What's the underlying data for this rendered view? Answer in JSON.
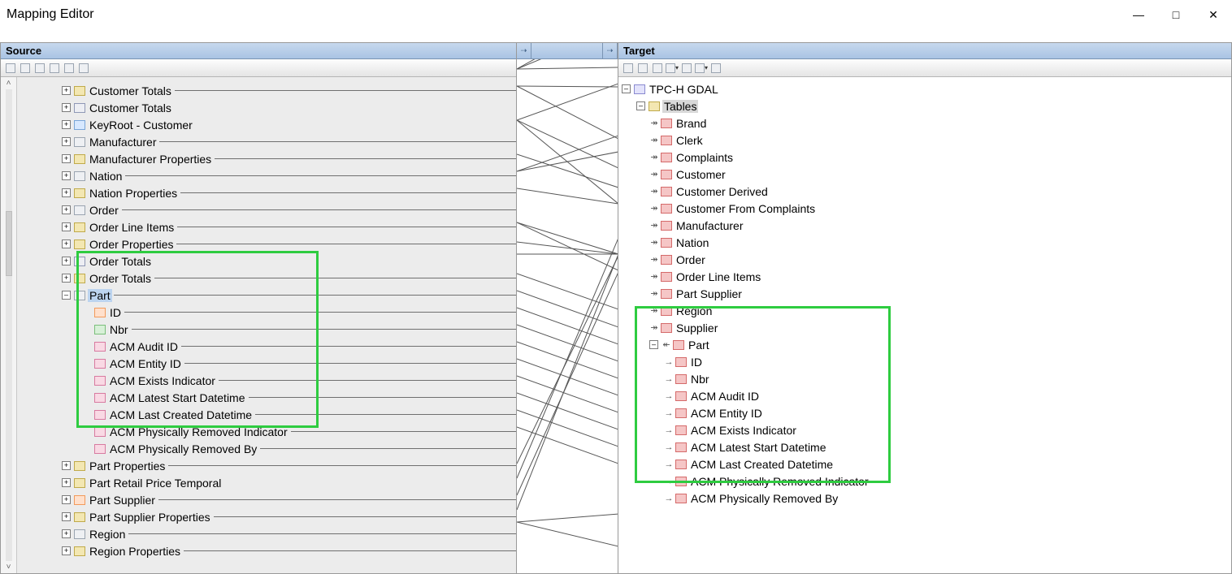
{
  "window": {
    "title": "Mapping Editor",
    "min": "—",
    "max": "□",
    "close": "✕"
  },
  "panels": {
    "source": "Source",
    "target": "Target"
  },
  "source_toolbar": [
    "tb1",
    "tb2",
    "tb3",
    "tb4",
    "tb5",
    "tb6"
  ],
  "target_toolbar": [
    "tt1",
    "tt2",
    "tt3",
    "tt4",
    "tt5",
    "tt6",
    "tt7"
  ],
  "source_tree": [
    {
      "exp": "+",
      "ico": "ic-folder",
      "label": "Customer Totals",
      "line": true
    },
    {
      "exp": "+",
      "ico": "ic-chart",
      "label": "Customer Totals"
    },
    {
      "exp": "+",
      "ico": "ic-key",
      "label": "KeyRoot - Customer"
    },
    {
      "exp": "+",
      "ico": "ic-grid",
      "label": "Manufacturer",
      "line": true
    },
    {
      "exp": "+",
      "ico": "ic-folder",
      "label": "Manufacturer Properties",
      "line": true
    },
    {
      "exp": "+",
      "ico": "ic-grid",
      "label": "Nation",
      "line": true
    },
    {
      "exp": "+",
      "ico": "ic-folder",
      "label": "Nation Properties",
      "line": true
    },
    {
      "exp": "+",
      "ico": "ic-grid",
      "label": "Order",
      "line": true
    },
    {
      "exp": "+",
      "ico": "ic-folder",
      "label": "Order Line Items",
      "line": true
    },
    {
      "exp": "+",
      "ico": "ic-folder",
      "label": "Order Properties",
      "line": true
    },
    {
      "exp": "+",
      "ico": "ic-chart",
      "label": "Order Totals"
    },
    {
      "exp": "+",
      "ico": "ic-folder",
      "label": "Order Totals",
      "line": true
    },
    {
      "exp": "–",
      "ico": "ic-grid",
      "label": "Part",
      "line": true,
      "highlight": true
    },
    {
      "child": true,
      "ico": "ic-orange",
      "label": "ID",
      "line": true
    },
    {
      "child": true,
      "ico": "ic-green",
      "label": "Nbr",
      "line": true
    },
    {
      "child": true,
      "ico": "ic-pink",
      "label": "ACM Audit ID",
      "line": true
    },
    {
      "child": true,
      "ico": "ic-pink",
      "label": "ACM Entity ID",
      "line": true
    },
    {
      "child": true,
      "ico": "ic-pink",
      "label": "ACM Exists Indicator",
      "line": true
    },
    {
      "child": true,
      "ico": "ic-pink",
      "label": "ACM Latest Start Datetime",
      "line": true
    },
    {
      "child": true,
      "ico": "ic-pink",
      "label": "ACM Last Created Datetime",
      "line": true
    },
    {
      "child": true,
      "ico": "ic-pink",
      "label": "ACM Physically Removed Indicator",
      "line": true
    },
    {
      "child": true,
      "ico": "ic-pink",
      "label": "ACM Physically Removed By",
      "line": true
    },
    {
      "exp": "+",
      "ico": "ic-folder",
      "label": "Part Properties",
      "line": true
    },
    {
      "exp": "+",
      "ico": "ic-folder",
      "label": "Part Retail Price Temporal"
    },
    {
      "exp": "+",
      "ico": "ic-orange",
      "label": "Part Supplier",
      "line": true
    },
    {
      "exp": "+",
      "ico": "ic-folder",
      "label": "Part Supplier Properties",
      "line": true
    },
    {
      "exp": "+",
      "ico": "ic-grid",
      "label": "Region",
      "line": true
    },
    {
      "exp": "+",
      "ico": "ic-folder",
      "label": "Region Properties",
      "line": true
    }
  ],
  "target_root": {
    "exp": "–",
    "ico": "ic-db",
    "label": "TPC-H GDAL"
  },
  "target_tables_label": "Tables",
  "target_tree": [
    {
      "arrow": "↠",
      "ico": "ic-red",
      "label": "Brand"
    },
    {
      "arrow": "↠",
      "ico": "ic-red",
      "label": "Clerk"
    },
    {
      "arrow": "↠",
      "ico": "ic-red",
      "label": "Complaints"
    },
    {
      "arrow": "↠",
      "ico": "ic-red",
      "label": "Customer"
    },
    {
      "arrow": "↠",
      "ico": "ic-red",
      "label": "Customer Derived"
    },
    {
      "arrow": "↠",
      "ico": "ic-red",
      "label": "Customer From Complaints"
    },
    {
      "arrow": "↠",
      "ico": "ic-red",
      "label": "Manufacturer"
    },
    {
      "arrow": "↠",
      "ico": "ic-red",
      "label": "Nation"
    },
    {
      "arrow": "↠",
      "ico": "ic-red",
      "label": "Order"
    },
    {
      "arrow": "↠",
      "ico": "ic-red",
      "label": "Order Line Items"
    },
    {
      "arrow": "↠",
      "ico": "ic-red",
      "label": "Part Supplier"
    },
    {
      "arrow": "↠",
      "ico": "ic-red",
      "label": "Region"
    },
    {
      "arrow": "↠",
      "ico": "ic-red",
      "label": "Supplier"
    },
    {
      "exp": "–",
      "arrow": "↞",
      "ico": "ic-red",
      "label": "Part",
      "indent": 0
    },
    {
      "arrow": "→",
      "ico": "ic-red",
      "label": "ID",
      "indent": 1
    },
    {
      "arrow": "→",
      "ico": "ic-red",
      "label": "Nbr",
      "indent": 1
    },
    {
      "arrow": "→",
      "ico": "ic-red",
      "label": "ACM Audit ID",
      "indent": 1
    },
    {
      "arrow": "→",
      "ico": "ic-red",
      "label": "ACM Entity ID",
      "indent": 1
    },
    {
      "arrow": "→",
      "ico": "ic-red",
      "label": "ACM Exists Indicator",
      "indent": 1
    },
    {
      "arrow": "→",
      "ico": "ic-red",
      "label": "ACM Latest Start Datetime",
      "indent": 1
    },
    {
      "arrow": "→",
      "ico": "ic-red",
      "label": "ACM Last Created Datetime",
      "indent": 1
    },
    {
      "arrow": "→",
      "ico": "ic-red",
      "label": "ACM Physically Removed Indicator",
      "indent": 1
    },
    {
      "arrow": "→",
      "ico": "ic-red",
      "label": "ACM Physically Removed By",
      "indent": 1
    }
  ],
  "mapping_lines": [
    [
      0,
      12,
      125,
      -58
    ],
    [
      0,
      12,
      125,
      -40
    ],
    [
      0,
      12,
      125,
      10
    ],
    [
      0,
      33,
      125,
      34
    ],
    [
      0,
      33,
      125,
      98
    ],
    [
      0,
      75,
      125,
      30
    ],
    [
      0,
      75,
      125,
      134
    ],
    [
      0,
      75,
      125,
      178
    ],
    [
      0,
      117,
      125,
      158
    ],
    [
      0,
      138,
      125,
      94
    ],
    [
      0,
      138,
      125,
      114
    ],
    [
      0,
      159,
      125,
      178
    ],
    [
      0,
      201,
      125,
      240
    ],
    [
      0,
      201,
      125,
      260
    ],
    [
      0,
      225,
      125,
      240
    ],
    [
      0,
      240,
      125,
      240
    ],
    [
      0,
      264,
      125,
      308
    ],
    [
      0,
      285,
      125,
      330
    ],
    [
      0,
      306,
      125,
      351
    ],
    [
      0,
      327,
      125,
      372
    ],
    [
      0,
      348,
      125,
      393
    ],
    [
      0,
      369,
      125,
      414
    ],
    [
      0,
      390,
      125,
      435
    ],
    [
      0,
      411,
      125,
      456
    ],
    [
      0,
      432,
      125,
      477
    ],
    [
      0,
      453,
      125,
      498
    ],
    [
      0,
      498,
      125,
      242
    ],
    [
      0,
      516,
      125,
      220
    ],
    [
      0,
      537,
      125,
      262
    ],
    [
      0,
      555,
      125,
      240
    ],
    [
      0,
      570,
      125,
      600
    ],
    [
      0,
      570,
      125,
      560
    ]
  ]
}
